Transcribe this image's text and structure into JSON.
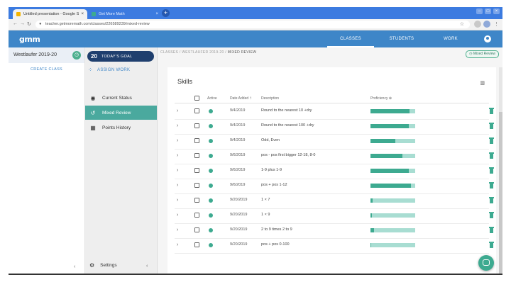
{
  "browser": {
    "tabs": [
      {
        "title": "Untitled presentation - Google Sl",
        "close": "×"
      },
      {
        "title": "Get More Math",
        "close": "×"
      }
    ],
    "new_tab": "+",
    "url": "teacher.getmoremath.com/classes/226589239/mixed-review",
    "colors": {
      "tabbar": "#3c7be0"
    }
  },
  "app": {
    "logo": "gmm",
    "nav": [
      {
        "label": "CLASSES",
        "active": true
      },
      {
        "label": "STUDENTS",
        "active": false
      },
      {
        "label": "WORK",
        "active": false
      }
    ],
    "colors": {
      "header": "#3e86c8",
      "accent": "#4aa99e",
      "goal": "#1f3f6e"
    }
  },
  "left_panel": {
    "class_name": "Westlaufer 2019-20",
    "create_class": "CREATE CLASS",
    "collapse": "‹"
  },
  "sidebar": {
    "goal_count": "20",
    "goal_label": "TODAY'S GOAL",
    "assign_work": "ASSIGN WORK",
    "items": [
      {
        "label": "Current Status",
        "icon": "gauge-icon",
        "active": false
      },
      {
        "label": "Mixed Review",
        "icon": "history-icon",
        "active": true
      },
      {
        "label": "Points History",
        "icon": "calendar-icon",
        "active": false
      }
    ],
    "settings": "Settings",
    "collapse": "‹"
  },
  "main": {
    "breadcrumb": {
      "root": "CLASSES",
      "sep1": "/",
      "class": "WESTLAUFER 2019-20",
      "sep2": "/",
      "current": "MIXED REVIEW"
    },
    "mixed_review_pill": "Mixed Review",
    "title": "Skills",
    "headers": {
      "active": "Active",
      "date_added": "Date Added",
      "sort": "↑",
      "description": "Description",
      "proficiency": "Proficiency ⊕"
    },
    "rows": [
      {
        "date": "9/4/2019",
        "description": "Round to the nearest 10 +dry",
        "proficiency": 0.88
      },
      {
        "date": "9/4/2019",
        "description": "Round to the nearest 100 +dry",
        "proficiency": 0.85
      },
      {
        "date": "9/4/2019",
        "description": "Odd, Even",
        "proficiency": 0.55
      },
      {
        "date": "9/6/2019",
        "description": "pos - pos first bigger 12-18, 8-0",
        "proficiency": 0.72
      },
      {
        "date": "9/6/2019",
        "description": "1-9 plus 1-9",
        "proficiency": 0.86
      },
      {
        "date": "9/6/2019",
        "description": "pos + pos 1-12",
        "proficiency": 0.9
      },
      {
        "date": "9/20/2019",
        "description": "1 × 7",
        "proficiency": 0.05
      },
      {
        "date": "9/20/2019",
        "description": "1 × 9",
        "proficiency": 0.03
      },
      {
        "date": "9/20/2019",
        "description": "2 to 9 times 2 to 9",
        "proficiency": 0.08
      },
      {
        "date": "9/20/2019",
        "description": "pos + pos 0-100",
        "proficiency": 0.02
      }
    ]
  }
}
